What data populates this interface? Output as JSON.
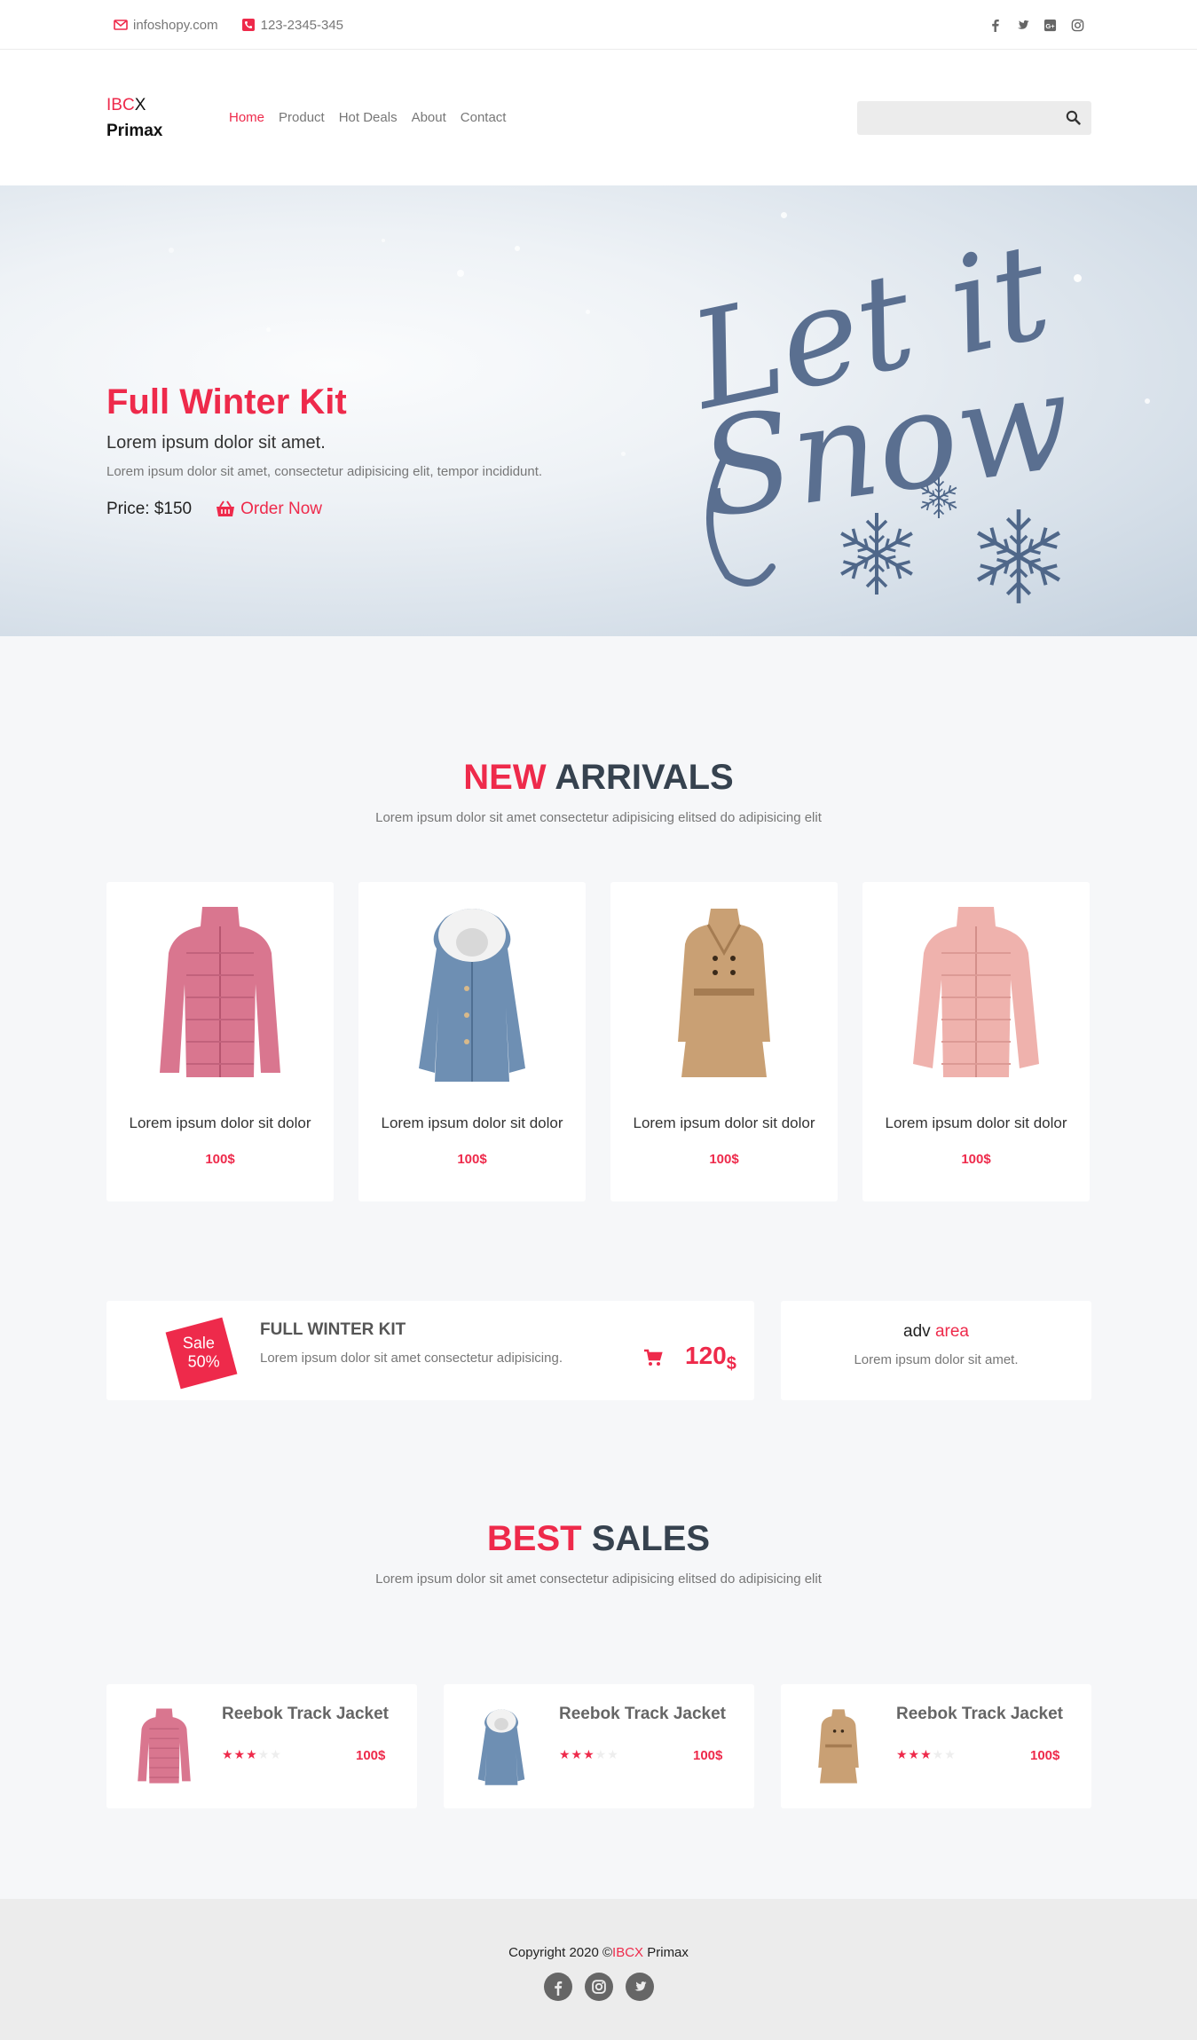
{
  "topbar": {
    "email": "infoshopy.com",
    "phone": "123-2345-345",
    "social_icons": [
      "facebook-icon",
      "twitter-icon",
      "google-plus-icon",
      "instagram-icon"
    ]
  },
  "brand": {
    "prefix_red": "IBC",
    "prefix_dark": "X",
    "name": "Primax"
  },
  "nav": [
    {
      "label": "Home",
      "active": true
    },
    {
      "label": "Product"
    },
    {
      "label": "Hot Deals"
    },
    {
      "label": "About"
    },
    {
      "label": "Contact"
    }
  ],
  "search": {
    "placeholder": ""
  },
  "hero": {
    "title": "Full Winter Kit",
    "subtitle": "Lorem ipsum dolor sit amet.",
    "description": "Lorem ipsum dolor sit amet, consectetur adipisicing elit, tempor incididunt.",
    "price": "Price: $150",
    "cta": "Order Now",
    "art_line1": "Let it",
    "art_line2": "Snow"
  },
  "new_arrivals": {
    "title_red": "NEW",
    "title_dark": "ARRIVALS",
    "subtitle": "Lorem ipsum dolor sit amet consectetur adipisicing elitsed do adipisicing elit",
    "products": [
      {
        "name": "Lorem ipsum dolor sit dolor",
        "price": "100$",
        "image": "pink-puffer-jacket"
      },
      {
        "name": "Lorem ipsum dolor sit dolor",
        "price": "100$",
        "image": "blue-fur-hood-coat"
      },
      {
        "name": "Lorem ipsum dolor sit dolor",
        "price": "100$",
        "image": "camel-trench-coat"
      },
      {
        "name": "Lorem ipsum dolor sit dolor",
        "price": "100$",
        "image": "peach-puffer-jacket"
      }
    ]
  },
  "promo": {
    "badge_line1": "Sale",
    "badge_line2": "50%",
    "title": "FULL WINTER KIT",
    "description": "Lorem ipsum dolor sit amet consectetur adipisicing.",
    "price": "120",
    "currency": "$"
  },
  "adv": {
    "title_dark": "adv",
    "title_red": "area",
    "description": "Lorem ipsum dolor sit amet."
  },
  "best_sales": {
    "title_red": "BEST",
    "title_dark": "SALES",
    "subtitle": "Lorem ipsum dolor sit amet consectetur adipisicing elitsed do adipisicing elit",
    "items": [
      {
        "name": "Reebok Track Jacket",
        "price": "100$",
        "rating": 3,
        "max_rating": 5,
        "image": "pink-puffer-jacket"
      },
      {
        "name": "Reebok Track Jacket",
        "price": "100$",
        "rating": 3,
        "max_rating": 5,
        "image": "blue-fur-hood-coat"
      },
      {
        "name": "Reebok Track Jacket",
        "price": "100$",
        "rating": 3,
        "max_rating": 5,
        "image": "camel-trench-coat"
      }
    ]
  },
  "footer": {
    "copyright_prefix": "Copyright 2020 ©",
    "copyright_brand_red": "IBCX",
    "copyright_brand_dark": " Primax",
    "social_icons": [
      "facebook-icon",
      "instagram-icon",
      "twitter-icon"
    ]
  },
  "colors": {
    "accent": "#ee2a4b",
    "heading": "#36424f",
    "muted": "#777777",
    "page_bg": "#f6f7f9"
  }
}
